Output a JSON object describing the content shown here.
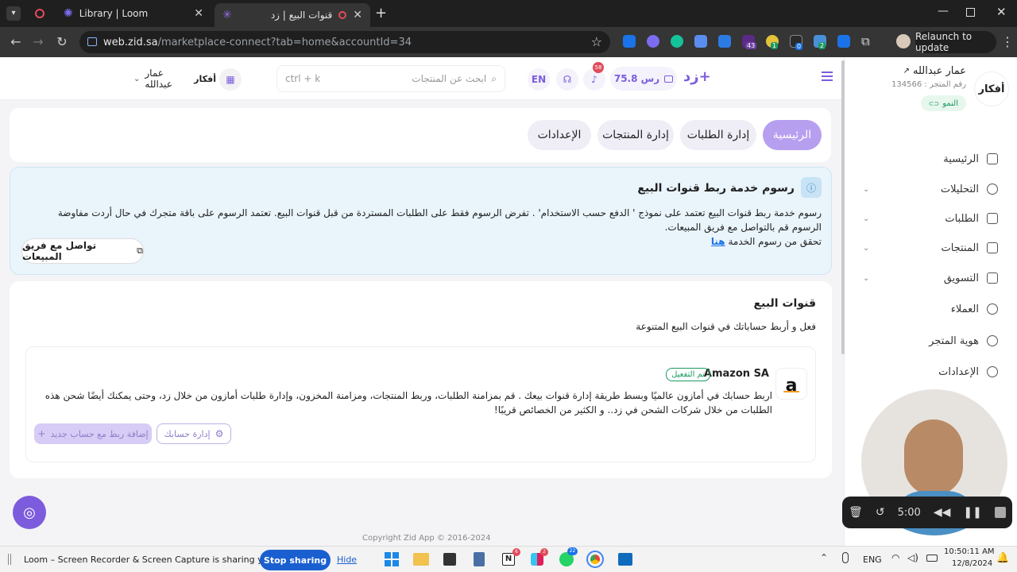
{
  "browser": {
    "tabs": [
      {
        "title": "Library | Loom",
        "active": false
      },
      {
        "title": "قنوات البيع | زد",
        "active": true
      }
    ],
    "url_host": "web.zid.sa",
    "url_path": "/marketplace-connect?tab=home&accountId=34",
    "relaunch_label": "Relaunch to update",
    "ext_badge_a": "43",
    "ext_badge_b": "1",
    "ext_badge_c": "0",
    "ext_badge_d": "2"
  },
  "header": {
    "logo": "زد+",
    "balance": "75.8 رس",
    "notifications_count": "58",
    "lang": "EN",
    "search_placeholder": "ابحث عن  المنتجات",
    "search_shortcut": "ctrl + k",
    "store_user": "عمار عبدالله",
    "store_logo_text": "أفكار"
  },
  "sidebar": {
    "store_name": "عمار عبدالله",
    "store_id": "رقم المتجر : 134566",
    "plan_badge": "النمو",
    "items": [
      {
        "label": "الرئيسية",
        "icon": "home-icon",
        "chevron": false
      },
      {
        "label": "التحليلات",
        "icon": "chart-pie-icon",
        "chevron": true
      },
      {
        "label": "الطلبات",
        "icon": "cart-icon",
        "chevron": true
      },
      {
        "label": "المنتجات",
        "icon": "box-icon",
        "chevron": true
      },
      {
        "label": "التسويق",
        "icon": "megaphone-icon",
        "chevron": true
      },
      {
        "label": "العملاء",
        "icon": "users-icon",
        "chevron": false
      },
      {
        "label": "هوية المتجر",
        "icon": "palette-icon",
        "chevron": false
      },
      {
        "label": "الإعدادات",
        "icon": "gear-icon",
        "chevron": false
      }
    ]
  },
  "tabs": [
    "الرئيسية",
    "إدارة الطلبات",
    "إدارة المنتجات",
    "الإعدادات"
  ],
  "fees": {
    "title": "رسوم خدمة ربط قنوات البيع",
    "body": "رسوم خدمة ربط قنوات البيع تعتمد على نموذج ' الدفع حسب الاستخدام' . تفرض الرسوم فقط على الطلبات المستردة من قبل قنوات البيع. تعتمد الرسوم على باقة متجرك في حال أردت مفاوضة الرسوم قم بالتواصل مع فريق المبيعات.",
    "body2": "تحقق من رسوم الخدمة",
    "link": "هنا",
    "contact_button": "تواصل مع فريق المبيعات"
  },
  "channels": {
    "title": "قنوات البيع",
    "subtitle": "فعل و أربط حساباتك في قنوات البيع المتنوعة",
    "amazon": {
      "name": "Amazon SA",
      "status": "تم التفعيل",
      "description": "اربط حسابك في أمازون عالميًا وبسط طريقة إدارة قنوات بيعك . قم بمزامنة الطلبات، وربط المنتجات، ومزامنة المخزون، وإدارة طلبات أمازون من خلال زد، وحتى يمكنك أيضًا شحن هذه الطلبات من خلال شركات الشحن في زد.. و الكثير من الخصائص قريبًا!",
      "manage_button": "إدارة حسابك",
      "add_button": "إضافة ربط مع حساب جديد"
    }
  },
  "footer_copyright": "Copyright Zid App © 2016-2024",
  "loom": {
    "timer": "5:00",
    "sharing_text": "Loom – Screen Recorder & Screen Capture is sharing your screen.",
    "stop_label": "Stop sharing",
    "hide_label": "Hide"
  },
  "taskbar": {
    "lang": "ENG",
    "time": "10:50:11 AM",
    "date": "12/8/2024",
    "badge_notion": "6",
    "badge_slack": "2",
    "badge_whatsapp": "22"
  },
  "colors": {
    "accent": "#7c5cdc",
    "accent_light": "#b79ff0",
    "info_bg": "#e9f4fb",
    "success": "#1a9a60"
  }
}
